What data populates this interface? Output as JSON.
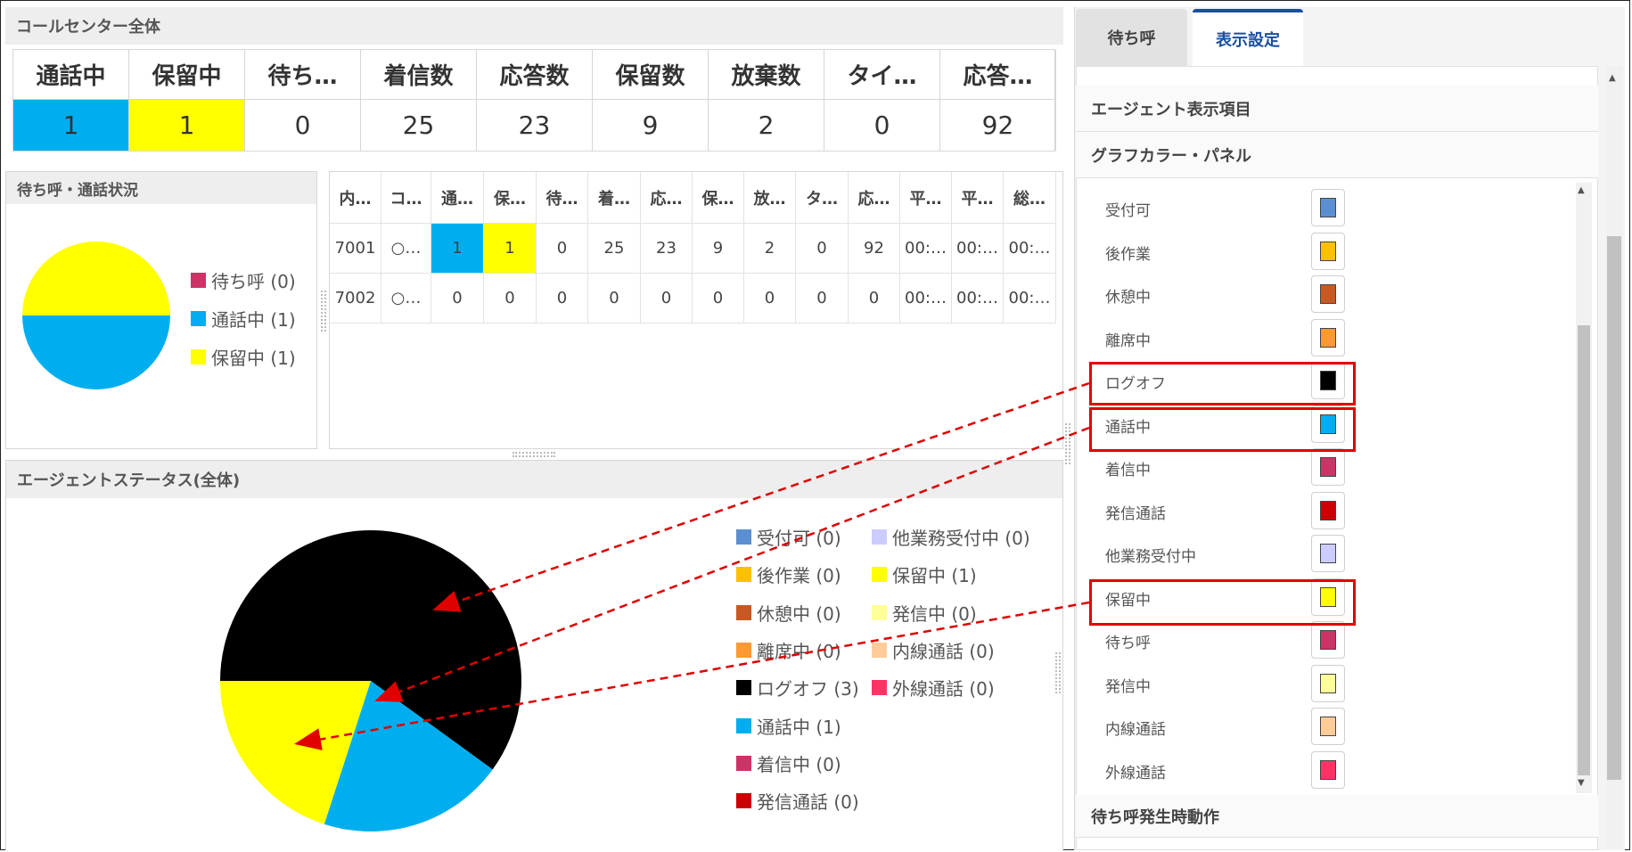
{
  "callcenter": {
    "title": "コールセンター全体",
    "headers": [
      "通話中",
      "保留中",
      "待ち…",
      "着信数",
      "応答数",
      "保留数",
      "放棄数",
      "タイ…",
      "応答…"
    ],
    "values": [
      "1",
      "1",
      "0",
      "25",
      "23",
      "9",
      "2",
      "0",
      "92"
    ],
    "highlight_colors": [
      "#00aeef",
      "#ffff00"
    ]
  },
  "queue_panel": {
    "title": "待ち呼・通話状況",
    "chart_data": {
      "type": "pie",
      "slices": [
        {
          "label": "待ち呼 (0)",
          "value": 0,
          "color": "#cc3366"
        },
        {
          "label": "通話中 (1)",
          "value": 1,
          "color": "#00aeef"
        },
        {
          "label": "保留中 (1)",
          "value": 1,
          "color": "#ffff00"
        }
      ]
    }
  },
  "agent_table": {
    "headers": [
      "内…",
      "コ…",
      "通…",
      "保…",
      "待…",
      "着…",
      "応…",
      "保…",
      "放…",
      "タ…",
      "応…",
      "平…",
      "平…",
      "総…"
    ],
    "rows": [
      [
        "7001",
        "○…",
        "1",
        "1",
        "0",
        "25",
        "23",
        "9",
        "2",
        "0",
        "92",
        "00:…",
        "00:…",
        "00:…"
      ],
      [
        "7002",
        "○…",
        "0",
        "0",
        "0",
        "0",
        "0",
        "0",
        "0",
        "0",
        "0",
        "00:…",
        "00:…",
        "00:…"
      ]
    ]
  },
  "agent_status": {
    "title": "エージェントステータス(全体)",
    "chart_data": {
      "type": "pie",
      "slices": [
        {
          "label": "ログオフ (3)",
          "value": 3,
          "color": "#000000"
        },
        {
          "label": "通話中 (1)",
          "value": 1,
          "color": "#00aeef"
        },
        {
          "label": "保留中 (1)",
          "value": 1,
          "color": "#ffff00"
        }
      ]
    },
    "legend_col1": [
      {
        "label": "受付可 (0)",
        "color": "#5b8fd1"
      },
      {
        "label": "後作業 (0)",
        "color": "#ffc000"
      },
      {
        "label": "休憩中 (0)",
        "color": "#c65a22"
      },
      {
        "label": "離席中 (0)",
        "color": "#ff9933"
      },
      {
        "label": "ログオフ (3)",
        "color": "#000000"
      },
      {
        "label": "通話中 (1)",
        "color": "#00aeef"
      },
      {
        "label": "着信中 (0)",
        "color": "#cc3366"
      },
      {
        "label": "発信通話 (0)",
        "color": "#cc0000"
      }
    ],
    "legend_col2": [
      {
        "label": "他業務受付中 (0)",
        "color": "#ccccff"
      },
      {
        "label": "保留中 (1)",
        "color": "#ffff00"
      },
      {
        "label": "発信中 (0)",
        "color": "#ffff99"
      },
      {
        "label": "内線通話 (0)",
        "color": "#ffcc99"
      },
      {
        "label": "外線通話 (0)",
        "color": "#ff3366"
      }
    ]
  },
  "right_panel": {
    "tabs": [
      "待ち呼",
      "表示設定"
    ],
    "active_tab": "表示設定",
    "sections": {
      "agent_items": "エージェント表示項目",
      "graph_color": "グラフカラー・パネル",
      "queue_action": "待ち呼発生時動作"
    },
    "color_items": [
      {
        "label": "受付可",
        "color": "#5b8fd1"
      },
      {
        "label": "後作業",
        "color": "#ffc000"
      },
      {
        "label": "休憩中",
        "color": "#c65a22"
      },
      {
        "label": "離席中",
        "color": "#ff9933"
      },
      {
        "label": "ログオフ",
        "color": "#000000"
      },
      {
        "label": "通話中",
        "color": "#00aeef"
      },
      {
        "label": "着信中",
        "color": "#cc3366"
      },
      {
        "label": "発信通話",
        "color": "#cc0000"
      },
      {
        "label": "他業務受付中",
        "color": "#ccccff"
      },
      {
        "label": "保留中",
        "color": "#ffff00"
      },
      {
        "label": "待ち呼",
        "color": "#cc3366"
      },
      {
        "label": "発信中",
        "color": "#ffff99"
      },
      {
        "label": "内線通話",
        "color": "#ffcc99"
      },
      {
        "label": "外線通話",
        "color": "#ff3366"
      }
    ]
  }
}
